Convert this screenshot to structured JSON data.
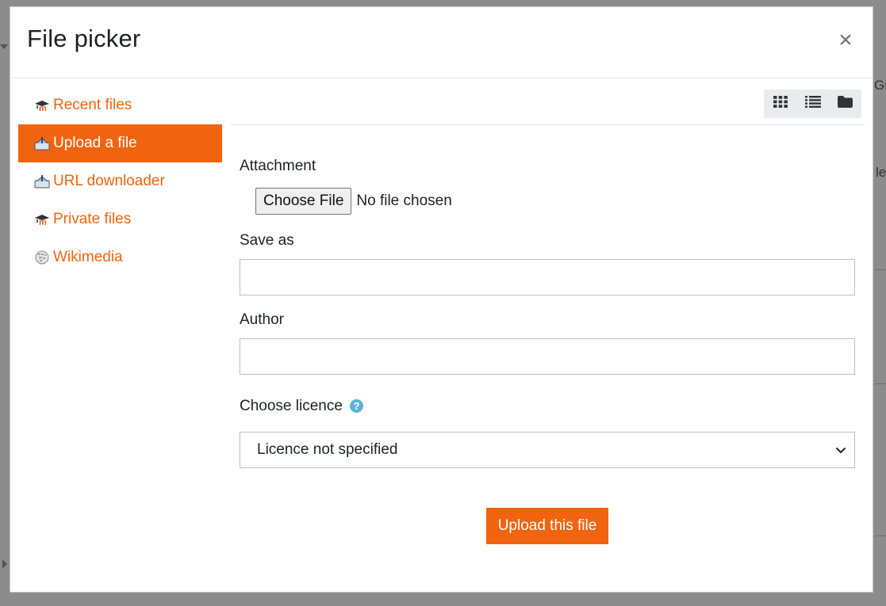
{
  "background": {
    "fragment_gr": "Gr",
    "fragment_e": "le"
  },
  "dialog": {
    "title": "File picker",
    "close_label": "×"
  },
  "sidebar": {
    "items": [
      {
        "label": "Recent files",
        "icon": "moodle-icon",
        "active": false
      },
      {
        "label": "Upload a file",
        "icon": "upload-icon",
        "active": true
      },
      {
        "label": "URL downloader",
        "icon": "url-download-icon",
        "active": false
      },
      {
        "label": "Private files",
        "icon": "moodle-icon",
        "active": false
      },
      {
        "label": "Wikimedia",
        "icon": "wikimedia-icon",
        "active": false
      }
    ]
  },
  "toolbar": {
    "views": [
      {
        "name": "icons-view",
        "icon": "grid-icon"
      },
      {
        "name": "details-view",
        "icon": "list-icon"
      },
      {
        "name": "tree-view",
        "icon": "folder-icon"
      }
    ]
  },
  "form": {
    "attachment_label": "Attachment",
    "choose_file_label": "Choose File",
    "no_file_text": "No file chosen",
    "save_as_label": "Save as",
    "save_as_value": "",
    "author_label": "Author",
    "author_value": "",
    "licence_label": "Choose licence",
    "help_glyph": "?",
    "licence_selected": "Licence not specified",
    "upload_button_label": "Upload this file"
  },
  "colors": {
    "accent": "#f0640f",
    "help": "#5ab4d6",
    "backdrop": "#8c8c8c"
  }
}
